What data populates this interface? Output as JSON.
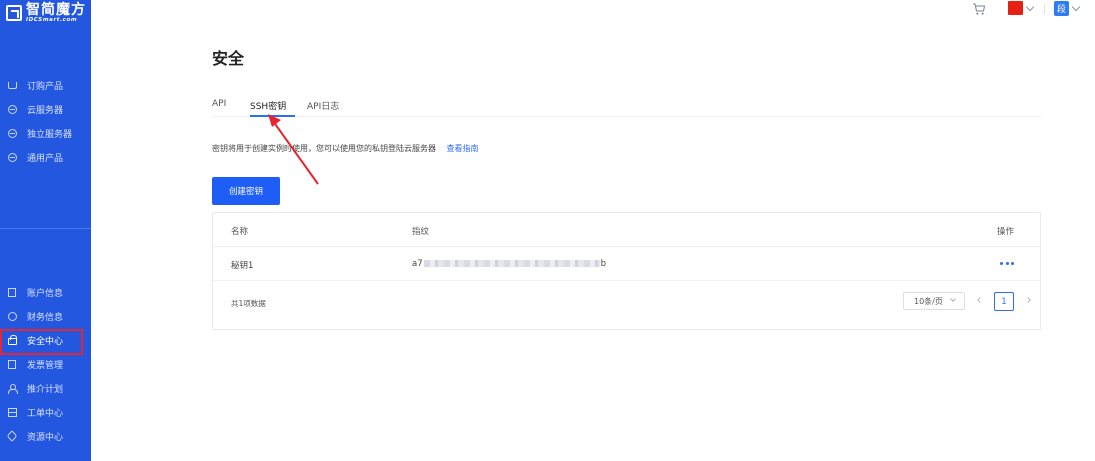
{
  "brand": {
    "name_cn": "智简魔方",
    "name_en": "IDCSmart.com"
  },
  "sidebar": {
    "top_items": [
      {
        "label": "订购产品",
        "icon": "cart-icon"
      },
      {
        "label": "云服务器",
        "icon": "database-icon"
      },
      {
        "label": "独立服务器",
        "icon": "database-icon"
      },
      {
        "label": "通用产品",
        "icon": "database-icon"
      }
    ],
    "bottom_items": [
      {
        "label": "账户信息",
        "icon": "id-card-icon"
      },
      {
        "label": "财务信息",
        "icon": "finance-icon"
      },
      {
        "label": "安全中心",
        "icon": "lock-icon",
        "active": true
      },
      {
        "label": "发票管理",
        "icon": "invoice-icon"
      },
      {
        "label": "推介计划",
        "icon": "user-icon"
      },
      {
        "label": "工单中心",
        "icon": "server-icon"
      },
      {
        "label": "资源中心",
        "icon": "tag-icon"
      }
    ]
  },
  "header": {
    "avatar_initial": "段"
  },
  "main": {
    "title": "安全",
    "tabs": [
      {
        "label": "API"
      },
      {
        "label": "SSH密钥",
        "active": true
      },
      {
        "label": "API日志"
      }
    ],
    "description": "密钥将用于创建实例时使用，您可以使用您的私钥登陆云服务器",
    "guide_link": "查看指南",
    "create_button": "创建密钥",
    "table": {
      "columns": [
        "名称",
        "指纹",
        "操作"
      ],
      "rows": [
        {
          "name": "秘钥1",
          "fingerprint_start": "a7",
          "fingerprint_end": "b"
        }
      ],
      "total_text": "共1项数据",
      "page_size": "10条/页",
      "current_page": "1"
    }
  },
  "colors": {
    "sidebar_bg": "#2357e0",
    "primary": "#1e5ef7",
    "link": "#2f6df6",
    "highlight_box": "#e3262f",
    "annotation_arrow": "#e3262f"
  }
}
